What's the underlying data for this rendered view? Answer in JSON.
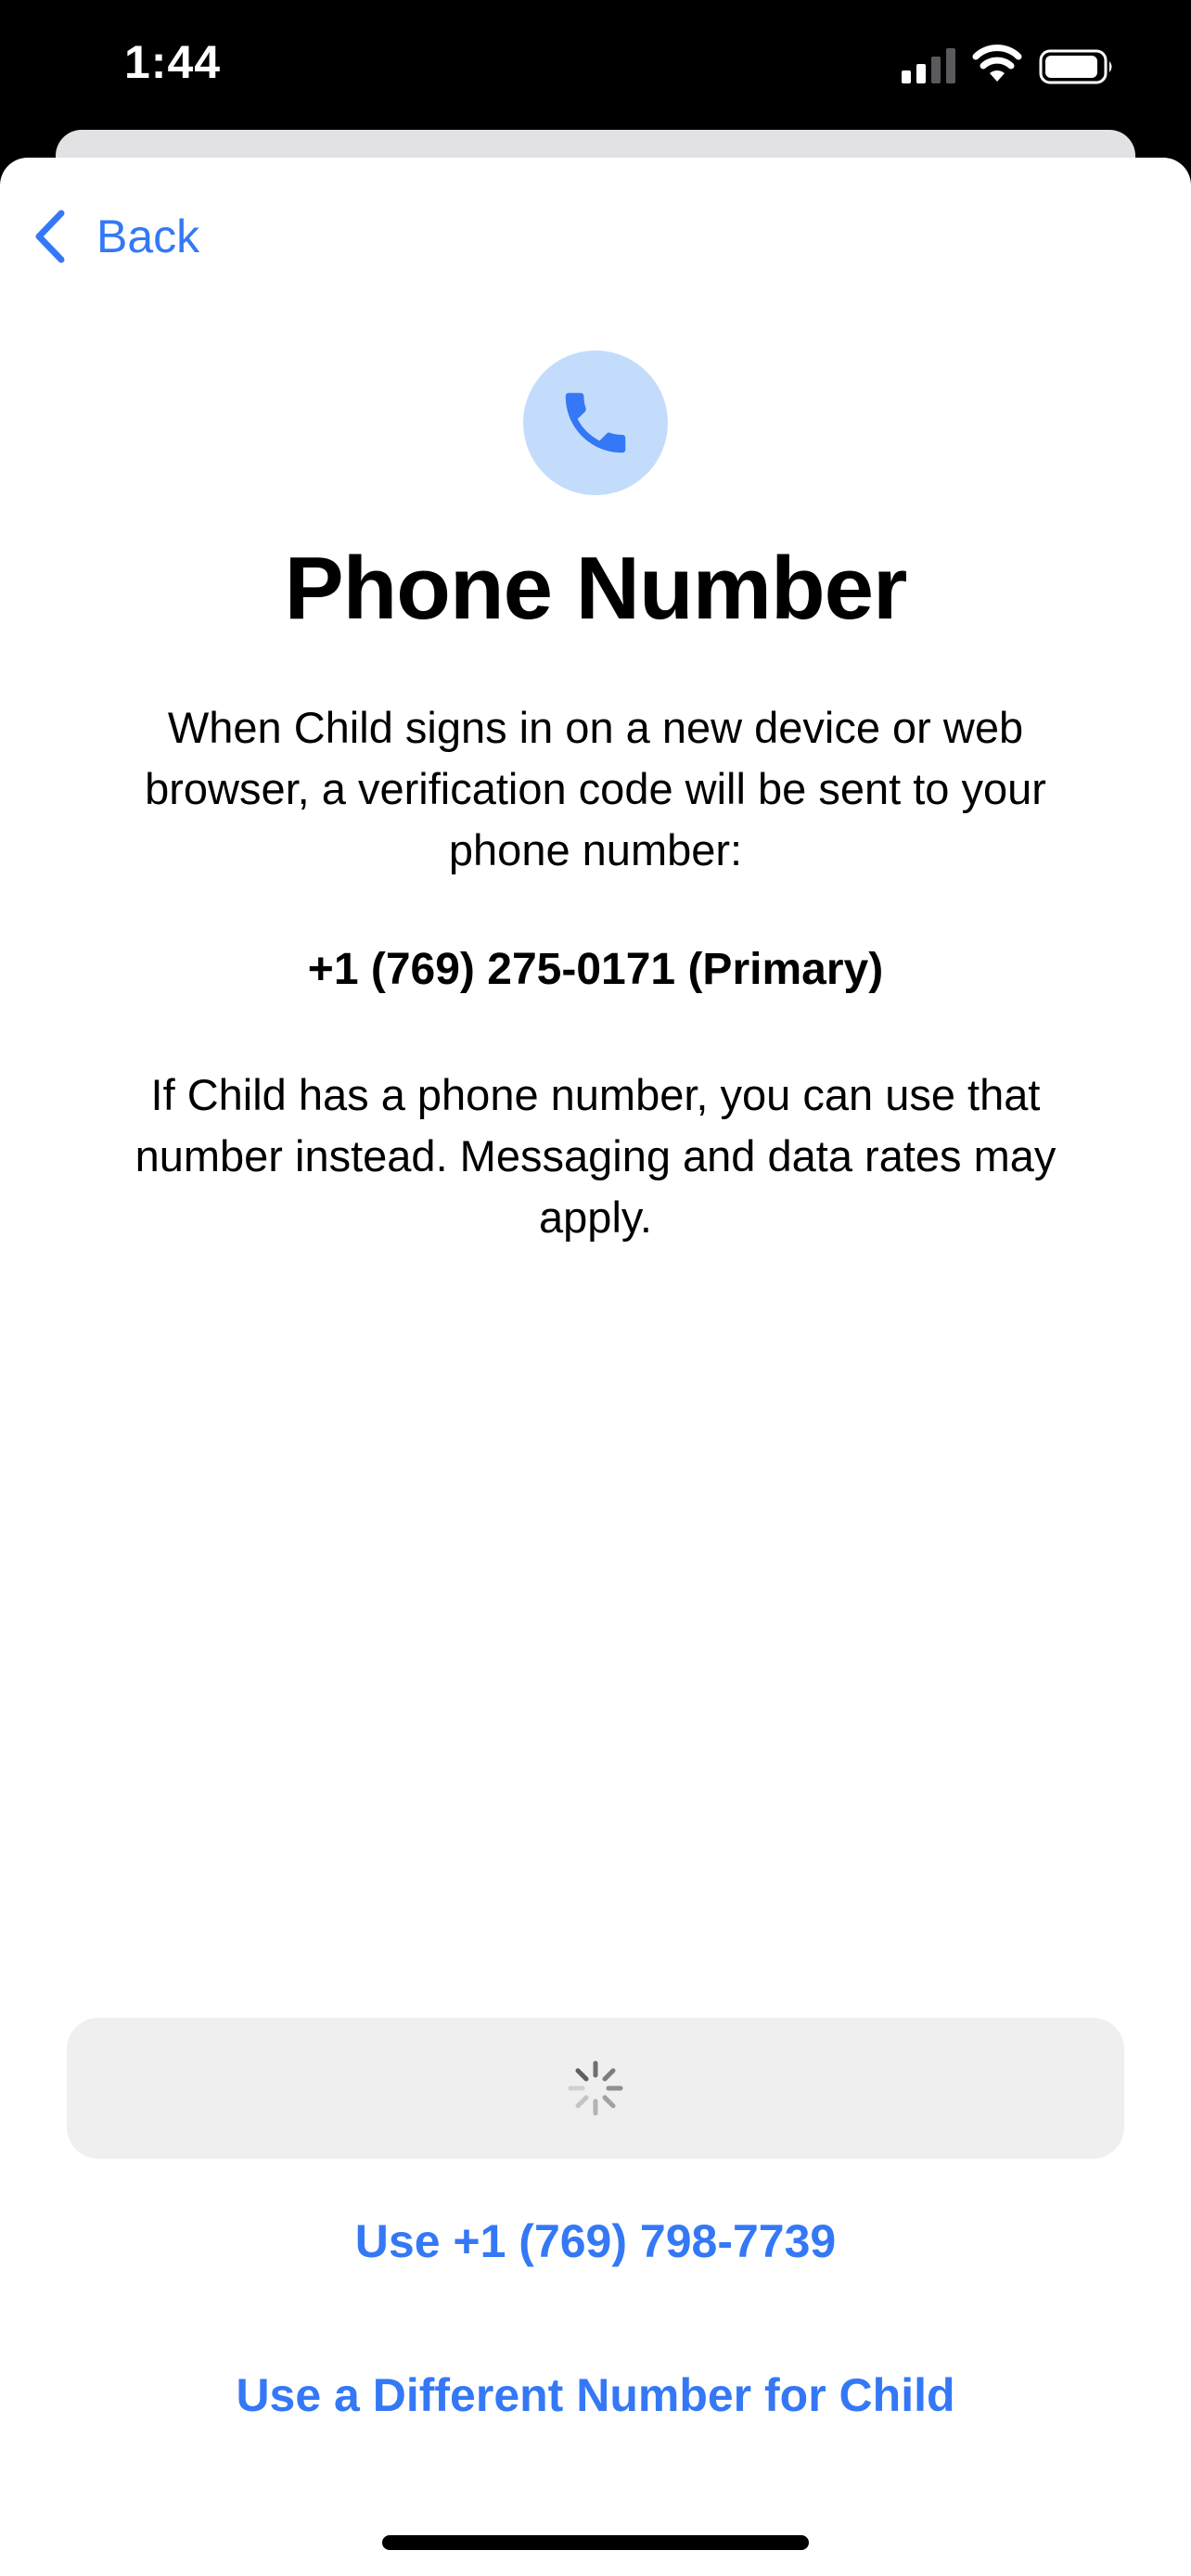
{
  "status_bar": {
    "time": "1:44"
  },
  "nav": {
    "back_label": "Back"
  },
  "content": {
    "icon": "phone-icon",
    "title": "Phone Number",
    "description_primary": "When Child signs in on a new device or web browser, a verification code will be sent to your phone number:",
    "primary_number": "+1 (769) 275-0171 (Primary)",
    "description_secondary": "If Child has a phone number, you can use that number instead. Messaging and data rates may apply."
  },
  "actions": {
    "continue_state": "loading",
    "use_number_label": "Use +1 (769) 798-7739",
    "different_number_label": "Use a Different Number for Child"
  },
  "colors": {
    "accent": "#3478f6",
    "icon_background": "#c4dcfb",
    "button_background": "#efeff0"
  }
}
